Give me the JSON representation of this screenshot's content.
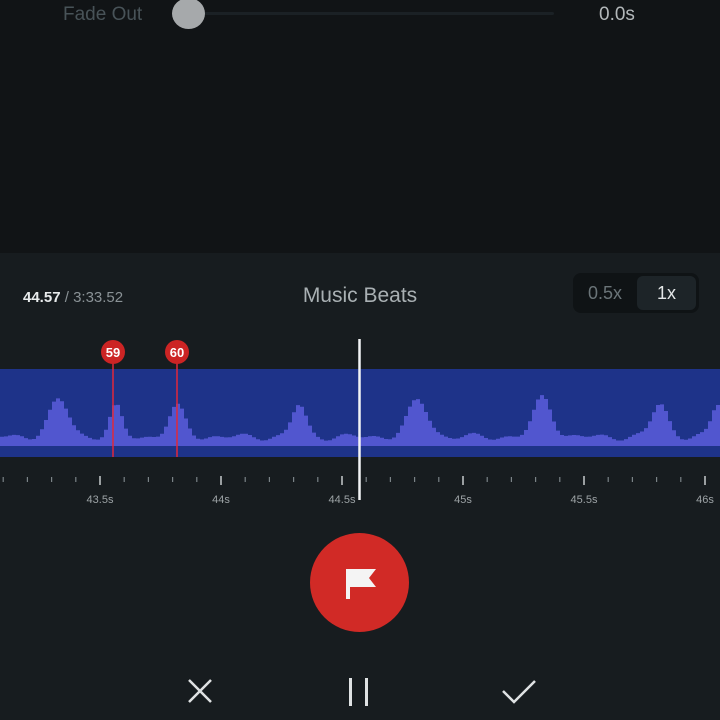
{
  "fade_out": {
    "label": "Fade Out",
    "value": "0.0s",
    "slider_fraction": 0.0
  },
  "player": {
    "current_time": "44.57",
    "separator": " / ",
    "total_time": "3:33.52"
  },
  "panel": {
    "title": "Music Beats"
  },
  "speed": {
    "options": [
      "0.5x",
      "1x"
    ],
    "selected": "1x"
  },
  "timeline": {
    "ticks": [
      "43.5s",
      "44s",
      "44.5s",
      "45s",
      "45.5s",
      "46s"
    ],
    "beat_markers": [
      "59",
      "60"
    ],
    "playhead_time": "44.57"
  },
  "icons": {
    "flag": "flag-icon",
    "cancel": "close-icon",
    "pause": "pause-icon",
    "confirm": "check-icon"
  },
  "colors": {
    "accent_red": "#d12a26",
    "waveform_bg": "#1e3389",
    "waveform_fill": "#5156cf",
    "panel_bg": "#171c1f"
  }
}
